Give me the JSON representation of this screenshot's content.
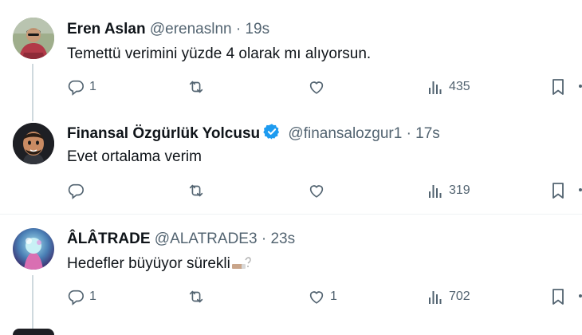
{
  "tweets": [
    {
      "name": "Eren Aslan",
      "handle": "@erenaslnn",
      "separator": "·",
      "time": "19s",
      "verified": false,
      "text": "Temettü verimini yüzde 4 olarak mı alıyorsun.",
      "replies": "1",
      "reposts": "",
      "likes": "",
      "views": "435"
    },
    {
      "name": "Finansal Özgürlük Yolcusu",
      "handle": "@finansalozgur1",
      "separator": "·",
      "time": "17s",
      "verified": true,
      "text": "Evet ortalama verim",
      "replies": "",
      "reposts": "",
      "likes": "",
      "views": "319"
    },
    {
      "name": "ÂLÂTRADE",
      "handle": "@ALATRADE3",
      "separator": "·",
      "time": "23s",
      "verified": false,
      "text": "Hedefler büyüyor sürekli",
      "replies": "1",
      "reposts": "",
      "likes": "1",
      "views": "702"
    }
  ],
  "icons": {
    "reply": "reply-icon",
    "repost": "repost-icon",
    "like": "like-icon",
    "views": "views-icon",
    "bookmark": "bookmark-icon",
    "verified": "verified-badge-icon"
  },
  "colors": {
    "text": "#0f1419",
    "secondary": "#536471",
    "verified": "#1d9bf0",
    "divider": "#eff3f4",
    "thread_line": "#cfd9de"
  }
}
